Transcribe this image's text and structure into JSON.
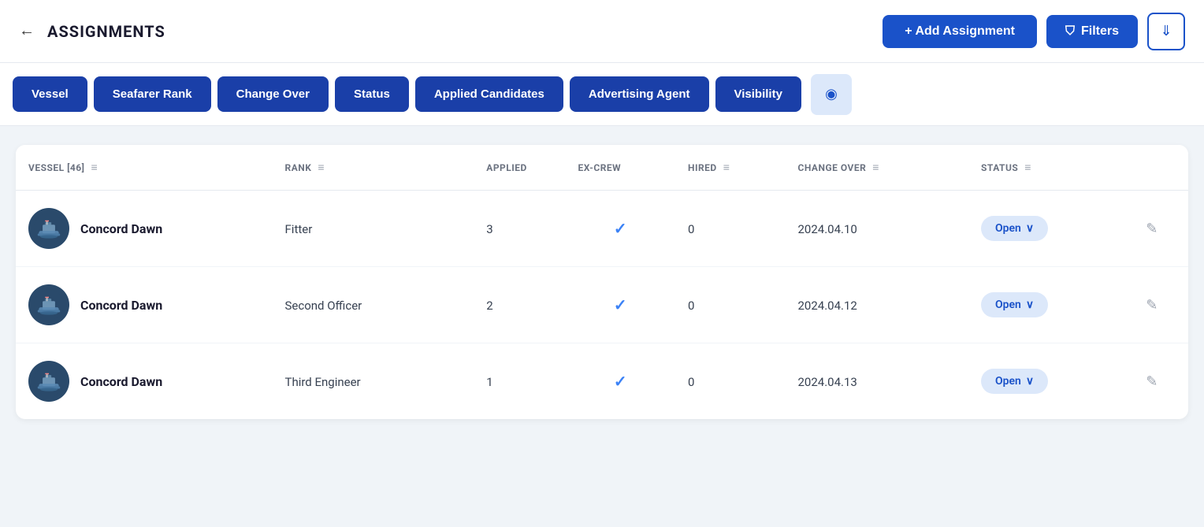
{
  "header": {
    "back_icon": "←",
    "title": "ASSIGNMENTS",
    "add_btn_label": "+ Add Assignment",
    "filters_btn_label": "Filters",
    "download_icon": "⬇"
  },
  "tabs": [
    {
      "id": "vessel",
      "label": "Vessel"
    },
    {
      "id": "seafarer-rank",
      "label": "Seafarer Rank"
    },
    {
      "id": "change-over",
      "label": "Change Over"
    },
    {
      "id": "status",
      "label": "Status"
    },
    {
      "id": "applied-candidates",
      "label": "Applied Candidates"
    },
    {
      "id": "advertising-agent",
      "label": "Advertising Agent"
    },
    {
      "id": "visibility",
      "label": "Visibility"
    }
  ],
  "table": {
    "columns": [
      {
        "id": "vessel",
        "label": "VESSEL [46]"
      },
      {
        "id": "rank",
        "label": "RANK"
      },
      {
        "id": "applied",
        "label": "APPLIED"
      },
      {
        "id": "excrew",
        "label": "EX-CREW"
      },
      {
        "id": "hired",
        "label": "HIRED"
      },
      {
        "id": "changeover",
        "label": "CHANGE OVER"
      },
      {
        "id": "status",
        "label": "STATUS"
      }
    ],
    "rows": [
      {
        "vessel": "Concord Dawn",
        "rank": "Fitter",
        "applied": "3",
        "excrew": true,
        "hired": "0",
        "changeover": "2024.04.10",
        "status": "Open"
      },
      {
        "vessel": "Concord Dawn",
        "rank": "Second Officer",
        "applied": "2",
        "excrew": true,
        "hired": "0",
        "changeover": "2024.04.12",
        "status": "Open"
      },
      {
        "vessel": "Concord Dawn",
        "rank": "Third Engineer",
        "applied": "1",
        "excrew": true,
        "hired": "0",
        "changeover": "2024.04.13",
        "status": "Open"
      }
    ]
  }
}
